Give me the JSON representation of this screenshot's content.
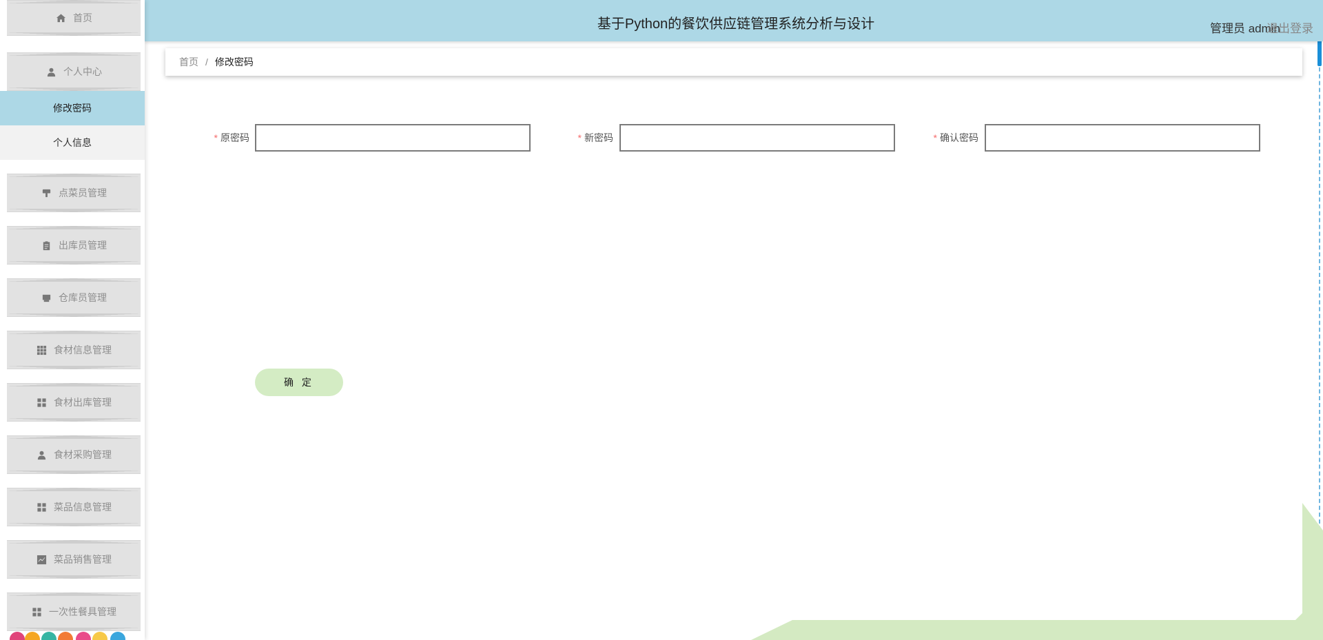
{
  "header": {
    "title": "基于Python的餐饮供应链管理系统分析与设计",
    "user_label": "管理员 admin",
    "logout_label": "退出登录"
  },
  "sidebar": {
    "home": {
      "label": "首页",
      "icon": "home-icon"
    },
    "personal_center": {
      "label": "个人中心",
      "icon": "user-icon"
    },
    "sub_items": [
      {
        "label": "修改密码",
        "active": true
      },
      {
        "label": "个人信息",
        "active": false
      }
    ],
    "items": [
      {
        "label": "点菜员管理",
        "icon": "brush-icon"
      },
      {
        "label": "出库员管理",
        "icon": "clipboard-icon"
      },
      {
        "label": "仓库员管理",
        "icon": "inbox-icon"
      },
      {
        "label": "食材信息管理",
        "icon": "grid-icon"
      },
      {
        "label": "食材出库管理",
        "icon": "apps-icon"
      },
      {
        "label": "食材采购管理",
        "icon": "user-icon"
      },
      {
        "label": "菜品信息管理",
        "icon": "apps-icon"
      },
      {
        "label": "菜品销售管理",
        "icon": "chart-icon"
      },
      {
        "label": "一次性餐具管理",
        "icon": "apps-icon"
      }
    ]
  },
  "breadcrumb": {
    "home": "首页",
    "separator": "/",
    "current": "修改密码"
  },
  "form": {
    "required_mark": "*",
    "old_password_label": "原密码",
    "new_password_label": "新密码",
    "confirm_password_label": "确认密码",
    "old_password_value": "",
    "new_password_value": "",
    "confirm_password_value": "",
    "submit_label": "确 定"
  },
  "colors": {
    "header_bg": "#add8e6",
    "active_menu_bg": "#add8e6",
    "menu_bg": "#e2e2e2",
    "button_bg": "#d4ecc4",
    "required": "#f56c6c",
    "deco_green": "#d4eac2"
  }
}
